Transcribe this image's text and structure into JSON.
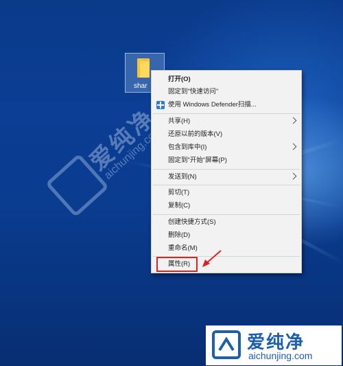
{
  "desktop": {
    "icon_label": "shar"
  },
  "watermark": {
    "cn": "爱纯净",
    "en": "aichunjing.com"
  },
  "context_menu": {
    "items": [
      {
        "label": "打开(O)"
      },
      {
        "label": "固定到\"快速访问\""
      },
      {
        "label": "使用 Windows Defender扫描..."
      },
      {
        "label": "共享(H)"
      },
      {
        "label": "还原以前的版本(V)"
      },
      {
        "label": "包含到库中(I)"
      },
      {
        "label": "固定到\"开始\"屏幕(P)"
      },
      {
        "label": "发送到(N)"
      },
      {
        "label": "剪切(T)"
      },
      {
        "label": "复制(C)"
      },
      {
        "label": "创建快捷方式(S)"
      },
      {
        "label": "删除(D)"
      },
      {
        "label": "重命名(M)"
      },
      {
        "label": "属性(R)"
      }
    ]
  },
  "brand": {
    "cn": "爱纯净",
    "en": "aichunjing.com"
  },
  "colors": {
    "highlight": "#e02020",
    "menu_bg": "#f2f2f2",
    "brand_blue": "#1b5fae"
  }
}
